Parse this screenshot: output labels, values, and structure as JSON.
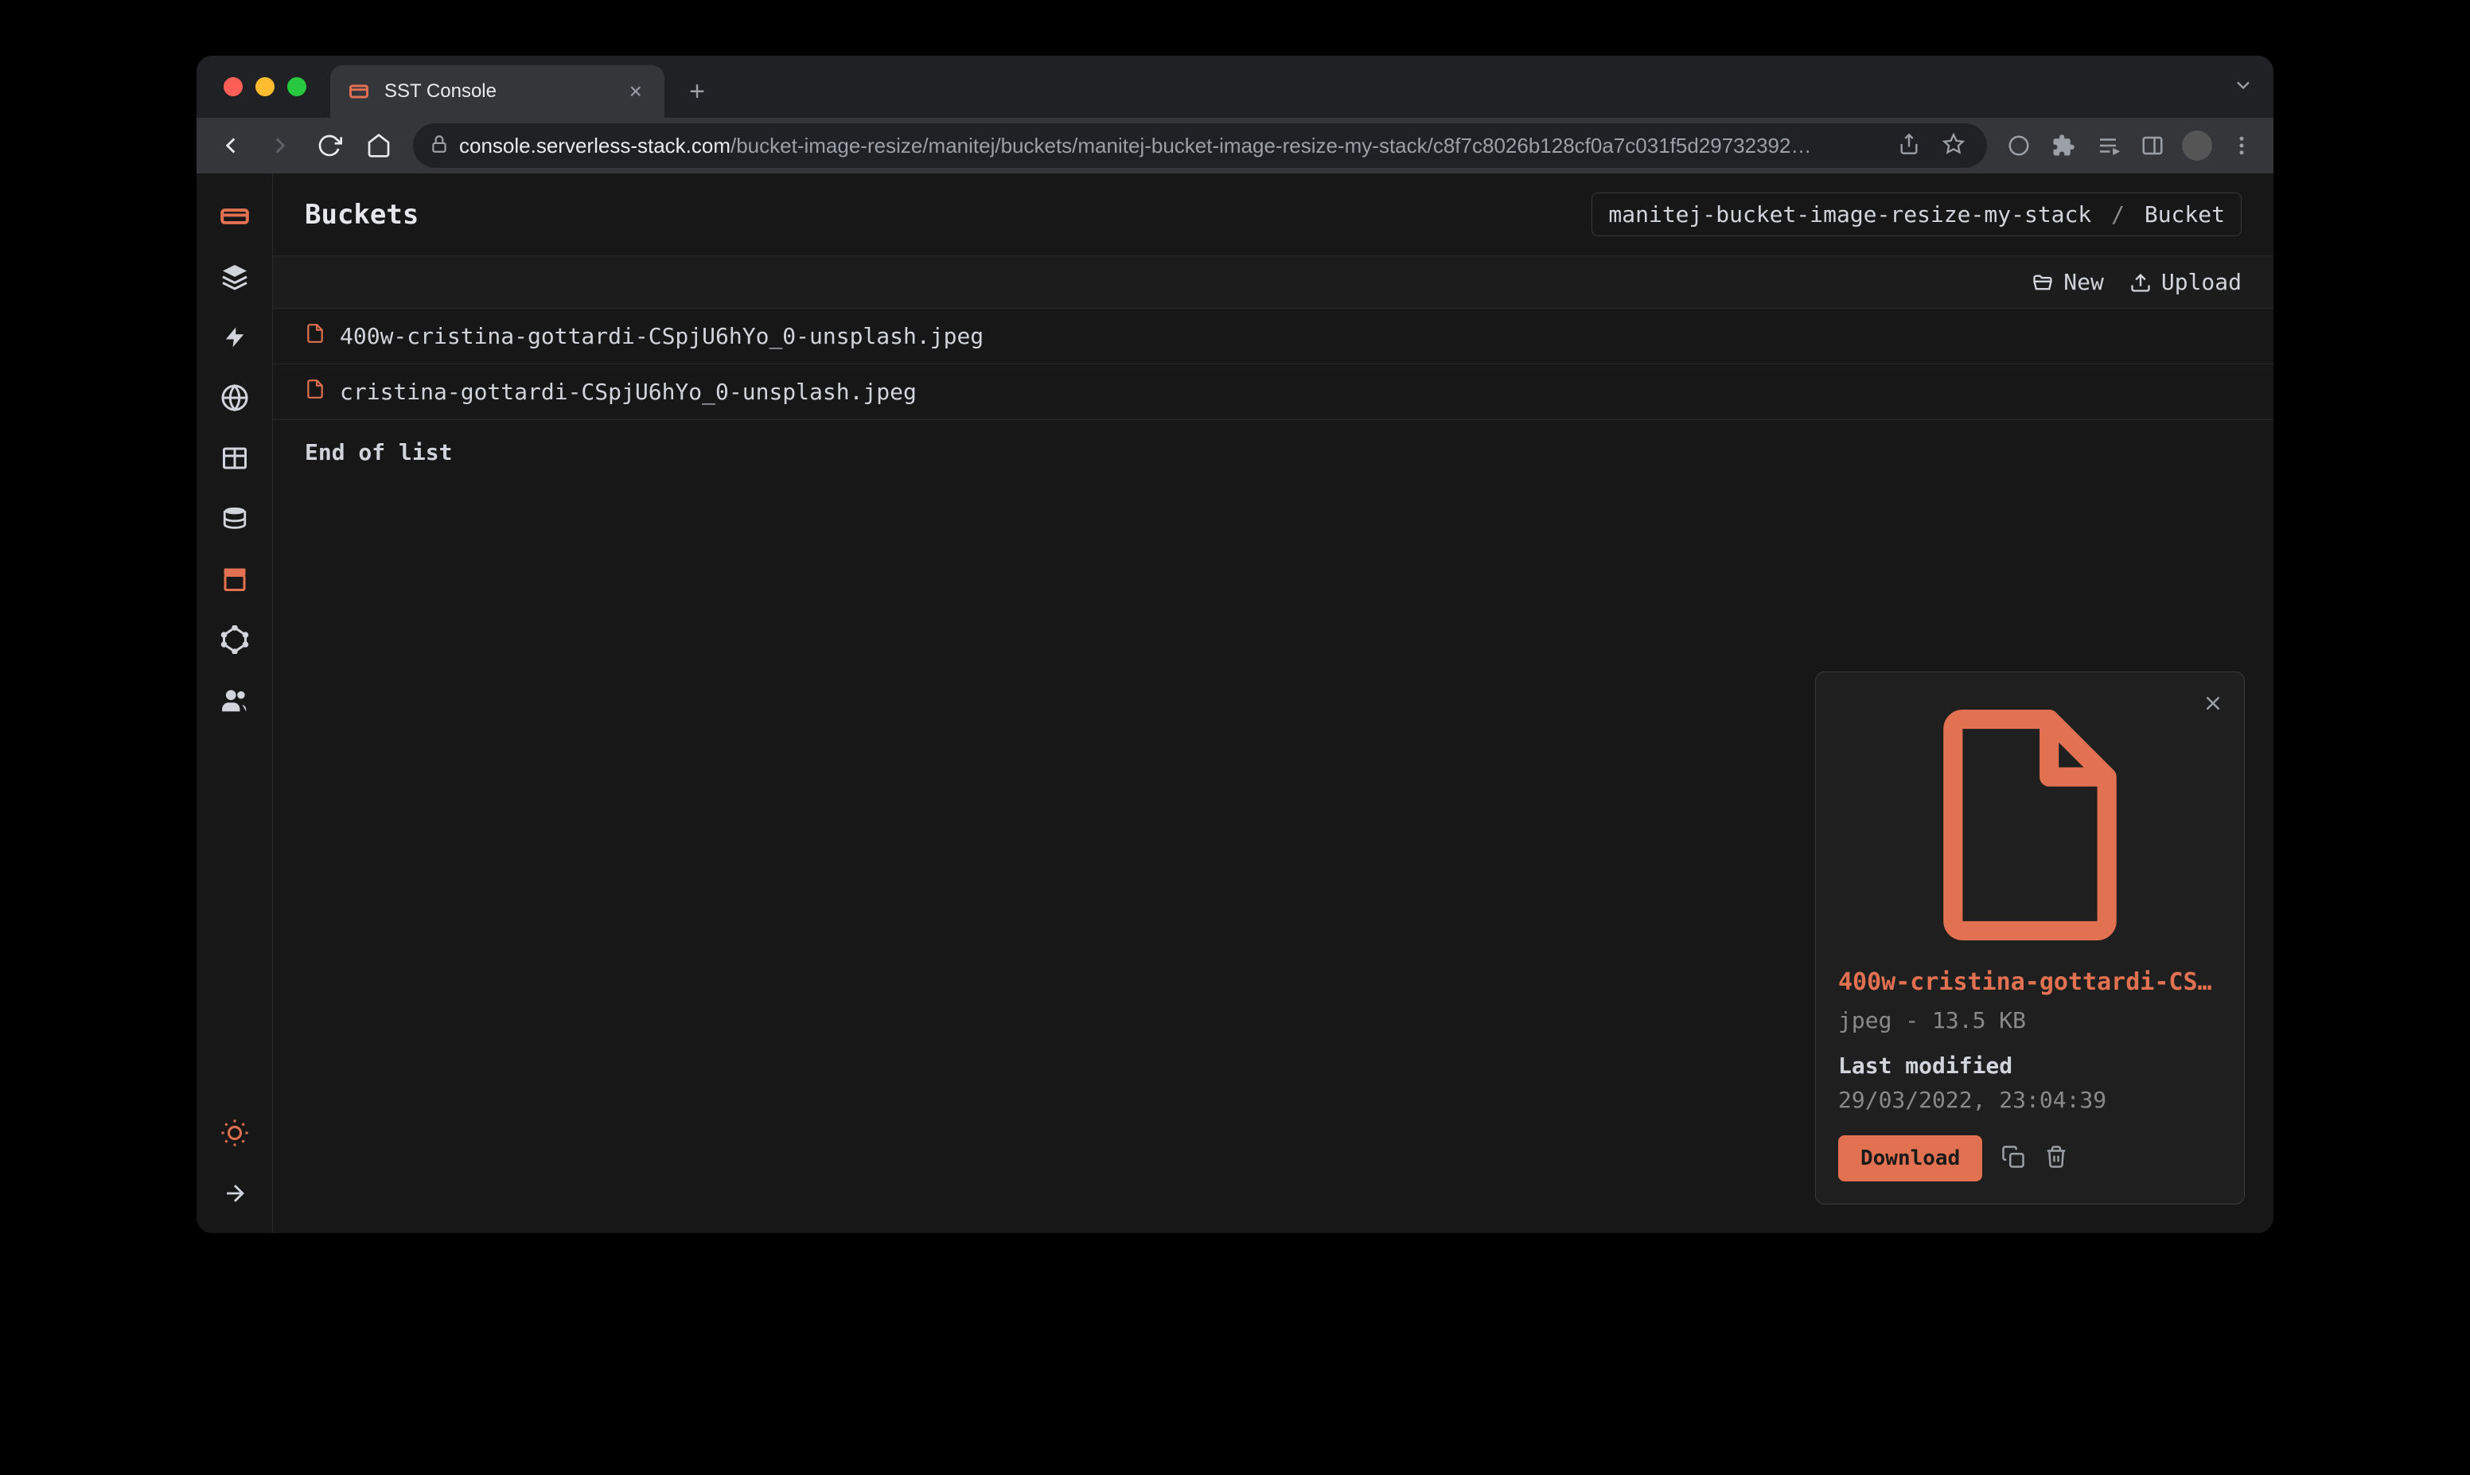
{
  "browser": {
    "tab_title": "SST Console",
    "url_host": "console.serverless-stack.com",
    "url_path": "/bucket-image-resize/manitej/buckets/manitej-bucket-image-resize-my-stack/c8f7c8026b128cf0a7c031f5d29732392…"
  },
  "header": {
    "title": "Buckets",
    "breadcrumb_stack": "manitej-bucket-image-resize-my-stack",
    "breadcrumb_sep": "/",
    "breadcrumb_resource": "Bucket"
  },
  "toolbar": {
    "new_label": "New",
    "upload_label": "Upload"
  },
  "files": [
    {
      "name": "400w-cristina-gottardi-CSpjU6hYo_0-unsplash.jpeg"
    },
    {
      "name": "cristina-gottardi-CSpjU6hYo_0-unsplash.jpeg"
    }
  ],
  "end_of_list": "End of list",
  "detail": {
    "filename": "400w-cristina-gottardi-CSp…",
    "type": "jpeg",
    "size_sep": " - ",
    "size": "13.5 KB",
    "last_modified_label": "Last modified",
    "last_modified_value": "29/03/2022, 23:04:39",
    "download_label": "Download"
  }
}
